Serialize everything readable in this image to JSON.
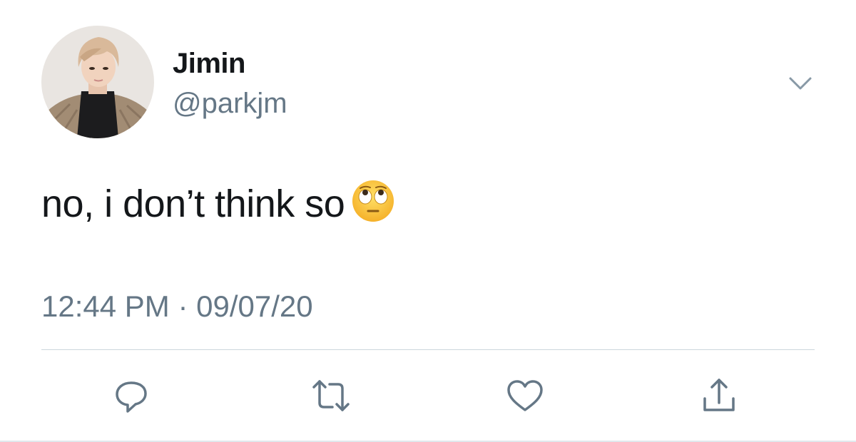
{
  "tweet": {
    "author": {
      "display_name": "Jimin",
      "handle": "@parkjm"
    },
    "text": "no, i don’t think so",
    "emoji": "face-with-rolling-eyes",
    "timestamp": "12:44 PM · 09/07/20"
  },
  "actions": [
    "reply-icon",
    "retweet-icon",
    "like-icon",
    "share-icon"
  ],
  "colors": {
    "text_primary": "#14171a",
    "text_secondary": "#657786",
    "divider": "#ccd6dd",
    "icon": "#657786"
  }
}
